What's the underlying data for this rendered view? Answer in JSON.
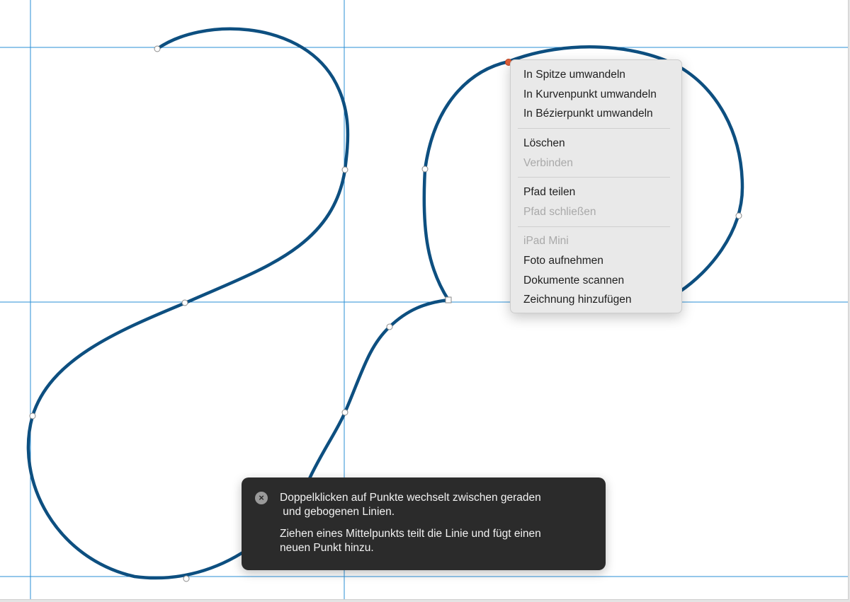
{
  "context_menu": {
    "items": [
      {
        "label": "In Spitze umwandeln",
        "enabled": true
      },
      {
        "label": "In Kurvenpunkt umwandeln",
        "enabled": true
      },
      {
        "label": "In Bézierpunkt umwandeln",
        "enabled": true
      },
      {
        "label": "Löschen",
        "enabled": true
      },
      {
        "label": "Verbinden",
        "enabled": false
      },
      {
        "label": "Pfad teilen",
        "enabled": true
      },
      {
        "label": "Pfad schließen",
        "enabled": false
      },
      {
        "label": "iPad Mini",
        "enabled": false
      },
      {
        "label": "Foto aufnehmen",
        "enabled": true
      },
      {
        "label": "Dokumente scannen",
        "enabled": true
      },
      {
        "label": "Zeichnung hinzufügen",
        "enabled": true
      }
    ]
  },
  "toast": {
    "close_icon": "close-icon",
    "line1": "Doppelklicken auf Punkte wechselt zwischen geraden",
    "line2": " und gebogenen Linien.",
    "line3": "Ziehen eines Mittelpunkts teilt die Linie und fügt einen",
    "line4": "neuen Punkt hinzu."
  },
  "colors": {
    "path_stroke": "#0d4f80",
    "guide_line": "#2a8fd6",
    "selected_point": "#e0603a",
    "toast_background": "#2b2b2b",
    "menu_background": "#e9e9e9"
  }
}
